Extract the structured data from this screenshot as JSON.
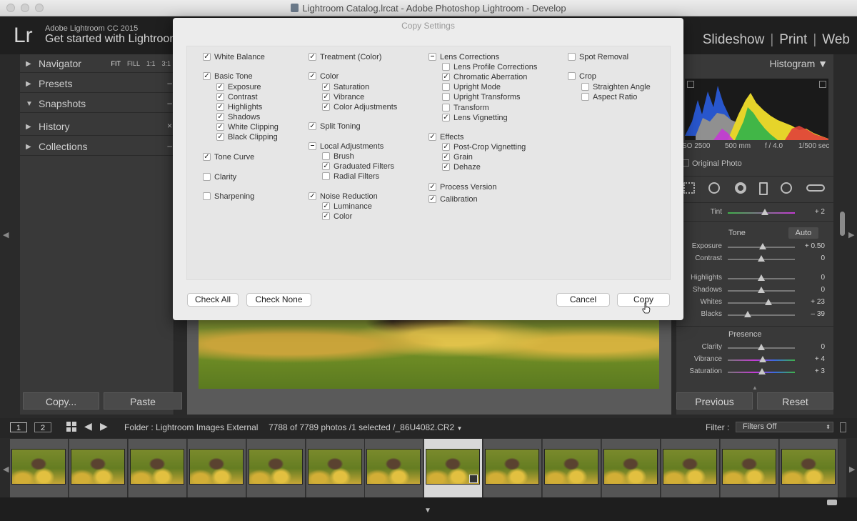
{
  "window": {
    "title": "Lightroom Catalog.lrcat - Adobe Photoshop Lightroom - Develop"
  },
  "header": {
    "logo": "Lr",
    "app_name": "Adobe Lightroom CC 2015",
    "identity": "Get started with Lightroom",
    "modules": [
      "Slideshow",
      "Print",
      "Web"
    ]
  },
  "left_panel": {
    "zoom_options": [
      "FIT",
      "FILL",
      "1:1",
      "3:1"
    ],
    "items": [
      {
        "label": "Navigator",
        "expanded": false
      },
      {
        "label": "Presets",
        "expanded": false
      },
      {
        "label": "Snapshots",
        "expanded": true
      },
      {
        "label": "History",
        "expanded": false
      },
      {
        "label": "Collections",
        "expanded": false
      }
    ],
    "copy_button": "Copy...",
    "paste_button": "Paste"
  },
  "right_panel": {
    "histogram_title": "Histogram",
    "exif": {
      "iso": "SO 2500",
      "focal": "500 mm",
      "aperture": "f / 4.0",
      "shutter": "1/500 sec"
    },
    "original_photo": "Original Photo",
    "tint": {
      "label": "Tint",
      "value": "+ 2",
      "position": 0.55
    },
    "tone_title": "Tone",
    "auto_label": "Auto",
    "tone_sliders": [
      {
        "label": "Exposure",
        "value": "+ 0.50",
        "position": 0.52
      },
      {
        "label": "Contrast",
        "value": "0",
        "position": 0.5
      }
    ],
    "tone_sliders2": [
      {
        "label": "Highlights",
        "value": "0",
        "position": 0.5
      },
      {
        "label": "Shadows",
        "value": "0",
        "position": 0.5
      },
      {
        "label": "Whites",
        "value": "+ 23",
        "position": 0.61
      },
      {
        "label": "Blacks",
        "value": "– 39",
        "position": 0.3
      }
    ],
    "presence_title": "Presence",
    "presence_sliders": [
      {
        "label": "Clarity",
        "value": "0",
        "position": 0.5
      },
      {
        "label": "Vibrance",
        "value": "+ 4",
        "position": 0.52
      },
      {
        "label": "Saturation",
        "value": "+ 3",
        "position": 0.51
      }
    ],
    "previous_button": "Previous",
    "reset_button": "Reset"
  },
  "filmstrip": {
    "page1": "1",
    "page2": "2",
    "folder": "Folder : Lightroom Images External",
    "count": "7788 of 7789 photos /1 selected /_86U4082.CR2",
    "filter_label": "Filter :",
    "filter_value": "Filters Off"
  },
  "dialog": {
    "title": "Copy Settings",
    "columns": [
      [
        {
          "label": "White Balance",
          "state": "checked",
          "level": 0,
          "row": 0
        },
        {
          "label": "Basic Tone",
          "state": "checked",
          "level": 0,
          "row": 1.95
        },
        {
          "label": "Exposure",
          "state": "checked",
          "level": 1,
          "row": 2.95
        },
        {
          "label": "Contrast",
          "state": "checked",
          "level": 1,
          "row": 3.95
        },
        {
          "label": "Highlights",
          "state": "checked",
          "level": 1,
          "row": 4.95
        },
        {
          "label": "Shadows",
          "state": "checked",
          "level": 1,
          "row": 5.95
        },
        {
          "label": "White Clipping",
          "state": "checked",
          "level": 1,
          "row": 6.95
        },
        {
          "label": "Black Clipping",
          "state": "checked",
          "level": 1,
          "row": 7.95
        },
        {
          "label": "Tone Curve",
          "state": "checked",
          "level": 0,
          "row": 9.95
        },
        {
          "label": "Clarity",
          "state": "unchecked",
          "level": 0,
          "row": 11.9
        },
        {
          "label": "Sharpening",
          "state": "unchecked",
          "level": 0,
          "row": 13.85
        }
      ],
      [
        {
          "label": "Treatment (Color)",
          "state": "checked",
          "level": 0,
          "row": 0
        },
        {
          "label": "Color",
          "state": "checked",
          "level": 0,
          "row": 1.95
        },
        {
          "label": "Saturation",
          "state": "checked",
          "level": 1,
          "row": 2.95
        },
        {
          "label": "Vibrance",
          "state": "checked",
          "level": 1,
          "row": 3.95
        },
        {
          "label": "Color Adjustments",
          "state": "checked",
          "level": 1,
          "row": 4.95
        },
        {
          "label": "Split Toning",
          "state": "checked",
          "level": 0,
          "row": 6.9
        },
        {
          "label": "Local Adjustments",
          "state": "mixed",
          "level": 0,
          "row": 8.85
        },
        {
          "label": "Brush",
          "state": "unchecked",
          "level": 1,
          "row": 9.85
        },
        {
          "label": "Graduated Filters",
          "state": "checked",
          "level": 1,
          "row": 10.85
        },
        {
          "label": "Radial Filters",
          "state": "unchecked",
          "level": 1,
          "row": 11.85
        },
        {
          "label": "Noise Reduction",
          "state": "checked",
          "level": 0,
          "row": 13.8
        },
        {
          "label": "Luminance",
          "state": "checked",
          "level": 1,
          "row": 14.8
        },
        {
          "label": "Color",
          "state": "checked",
          "level": 1,
          "row": 15.8
        }
      ],
      [
        {
          "label": "Lens Corrections",
          "state": "mixed",
          "level": 0,
          "row": 0
        },
        {
          "label": "Lens Profile Corrections",
          "state": "unchecked",
          "level": 1,
          "row": 1
        },
        {
          "label": "Chromatic Aberration",
          "state": "checked",
          "level": 1,
          "row": 2
        },
        {
          "label": "Upright Mode",
          "state": "unchecked",
          "level": 1,
          "row": 3
        },
        {
          "label": "Upright Transforms",
          "state": "unchecked",
          "level": 1,
          "row": 4
        },
        {
          "label": "Transform",
          "state": "unchecked",
          "level": 1,
          "row": 5
        },
        {
          "label": "Lens Vignetting",
          "state": "checked",
          "level": 1,
          "row": 6
        },
        {
          "label": "Effects",
          "state": "checked",
          "level": 0,
          "row": 7.95
        },
        {
          "label": "Post-Crop Vignetting",
          "state": "checked",
          "level": 1,
          "row": 8.95
        },
        {
          "label": "Grain",
          "state": "checked",
          "level": 1,
          "row": 9.95
        },
        {
          "label": "Dehaze",
          "state": "checked",
          "level": 1,
          "row": 10.95
        },
        {
          "label": "Process Version",
          "state": "checked",
          "level": 0,
          "row": 12.9
        },
        {
          "label": "Calibration",
          "state": "checked",
          "level": 0,
          "row": 14.1
        }
      ],
      [
        {
          "label": "Spot Removal",
          "state": "unchecked",
          "level": 0,
          "row": 0
        },
        {
          "label": "Crop",
          "state": "unchecked",
          "level": 0,
          "row": 1.95
        },
        {
          "label": "Straighten Angle",
          "state": "unchecked",
          "level": 1,
          "row": 2.95
        },
        {
          "label": "Aspect Ratio",
          "state": "unchecked",
          "level": 1,
          "row": 3.95
        }
      ]
    ],
    "check_all": "Check All",
    "check_none": "Check None",
    "cancel": "Cancel",
    "copy": "Copy"
  }
}
